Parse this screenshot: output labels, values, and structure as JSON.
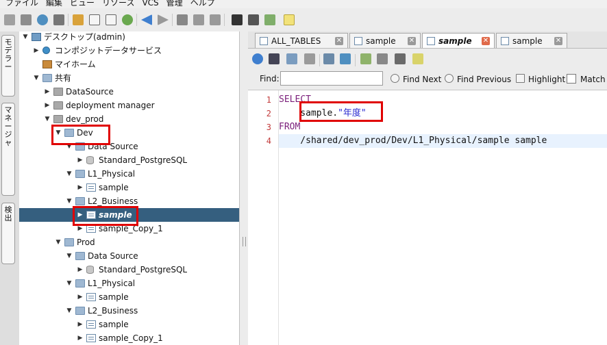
{
  "menu": [
    "ファイル",
    "編集",
    "ビュー",
    "リソース",
    "VCS",
    "管理",
    "ヘルプ"
  ],
  "left_tabs": [
    {
      "label": "モデラー"
    },
    {
      "label": "マネージャ"
    },
    {
      "label": "検出"
    }
  ],
  "tree": [
    {
      "label": "デスクトップ(admin)",
      "level": 0,
      "expanded": true,
      "icon": "monitor-icon"
    },
    {
      "label": "コンポジットデータサービス",
      "level": 1,
      "expanded": false,
      "icon": "globe-icon"
    },
    {
      "label": "マイホーム",
      "level": 1,
      "expanded": null,
      "icon": "home-icon"
    },
    {
      "label": "共有",
      "level": 1,
      "expanded": true,
      "icon": "shared-folder-icon"
    },
    {
      "label": "DataSource",
      "level": 2,
      "expanded": false,
      "icon": "folder-icon"
    },
    {
      "label": "deployment manager",
      "level": 2,
      "expanded": false,
      "icon": "folder-icon"
    },
    {
      "label": "dev_prod",
      "level": 2,
      "expanded": true,
      "icon": "folder-icon"
    },
    {
      "label": "Dev",
      "level": 3,
      "expanded": true,
      "icon": "folder-open-icon"
    },
    {
      "label": "Data Source",
      "level": 4,
      "expanded": true,
      "icon": "folder-open-icon"
    },
    {
      "label": "Standard_PostgreSQL",
      "level": 5,
      "expanded": false,
      "icon": "database-icon"
    },
    {
      "label": "L1_Physical",
      "level": 4,
      "expanded": true,
      "icon": "folder-open-icon"
    },
    {
      "label": "sample",
      "level": 5,
      "expanded": false,
      "icon": "view-icon"
    },
    {
      "label": "L2_Business",
      "level": 4,
      "expanded": true,
      "icon": "folder-open-icon"
    },
    {
      "label": "sample",
      "level": 5,
      "expanded": false,
      "icon": "view-icon",
      "selected": true
    },
    {
      "label": "sample_Copy_1",
      "level": 5,
      "expanded": false,
      "icon": "view-icon"
    },
    {
      "label": "Prod",
      "level": 3,
      "expanded": true,
      "icon": "folder-open-icon"
    },
    {
      "label": "Data Source",
      "level": 4,
      "expanded": true,
      "icon": "folder-open-icon"
    },
    {
      "label": "Standard_PostgreSQL",
      "level": 5,
      "expanded": false,
      "icon": "database-icon"
    },
    {
      "label": "L1_Physical",
      "level": 4,
      "expanded": true,
      "icon": "folder-open-icon"
    },
    {
      "label": "sample",
      "level": 5,
      "expanded": false,
      "icon": "view-icon"
    },
    {
      "label": "L2_Business",
      "level": 4,
      "expanded": true,
      "icon": "folder-open-icon"
    },
    {
      "label": "sample",
      "level": 5,
      "expanded": false,
      "icon": "view-icon"
    },
    {
      "label": "sample_Copy_1",
      "level": 5,
      "expanded": false,
      "icon": "view-icon"
    }
  ],
  "editor_tabs": [
    {
      "label": "ALL_TABLES",
      "active": false
    },
    {
      "label": "sample",
      "active": false
    },
    {
      "label": "sample",
      "active": true
    },
    {
      "label": "sample",
      "active": false
    }
  ],
  "find": {
    "label": "Find:",
    "value": "",
    "find_next": "Find Next",
    "find_previous": "Find Previous",
    "highlight": "Highlight",
    "match_case": "Match C"
  },
  "code": [
    {
      "n": "1",
      "tokens": [
        {
          "t": "SELECT",
          "c": "kw"
        }
      ]
    },
    {
      "n": "2",
      "tokens": [
        {
          "t": "    sample.",
          "c": ""
        },
        {
          "t": "\"年度\"",
          "c": "str"
        }
      ]
    },
    {
      "n": "3",
      "tokens": [
        {
          "t": "FROM",
          "c": "kw"
        }
      ]
    },
    {
      "n": "4",
      "tokens": [
        {
          "t": "    /shared/dev_prod/Dev/L1_Physical/sample sample",
          "c": ""
        }
      ],
      "current": true
    }
  ],
  "colors": {
    "selection": "#355f7f",
    "keyword": "#7a1e7a",
    "string": "#2a2ad0",
    "line_number": "#c23a3a",
    "highlight_box": "#e00000"
  }
}
